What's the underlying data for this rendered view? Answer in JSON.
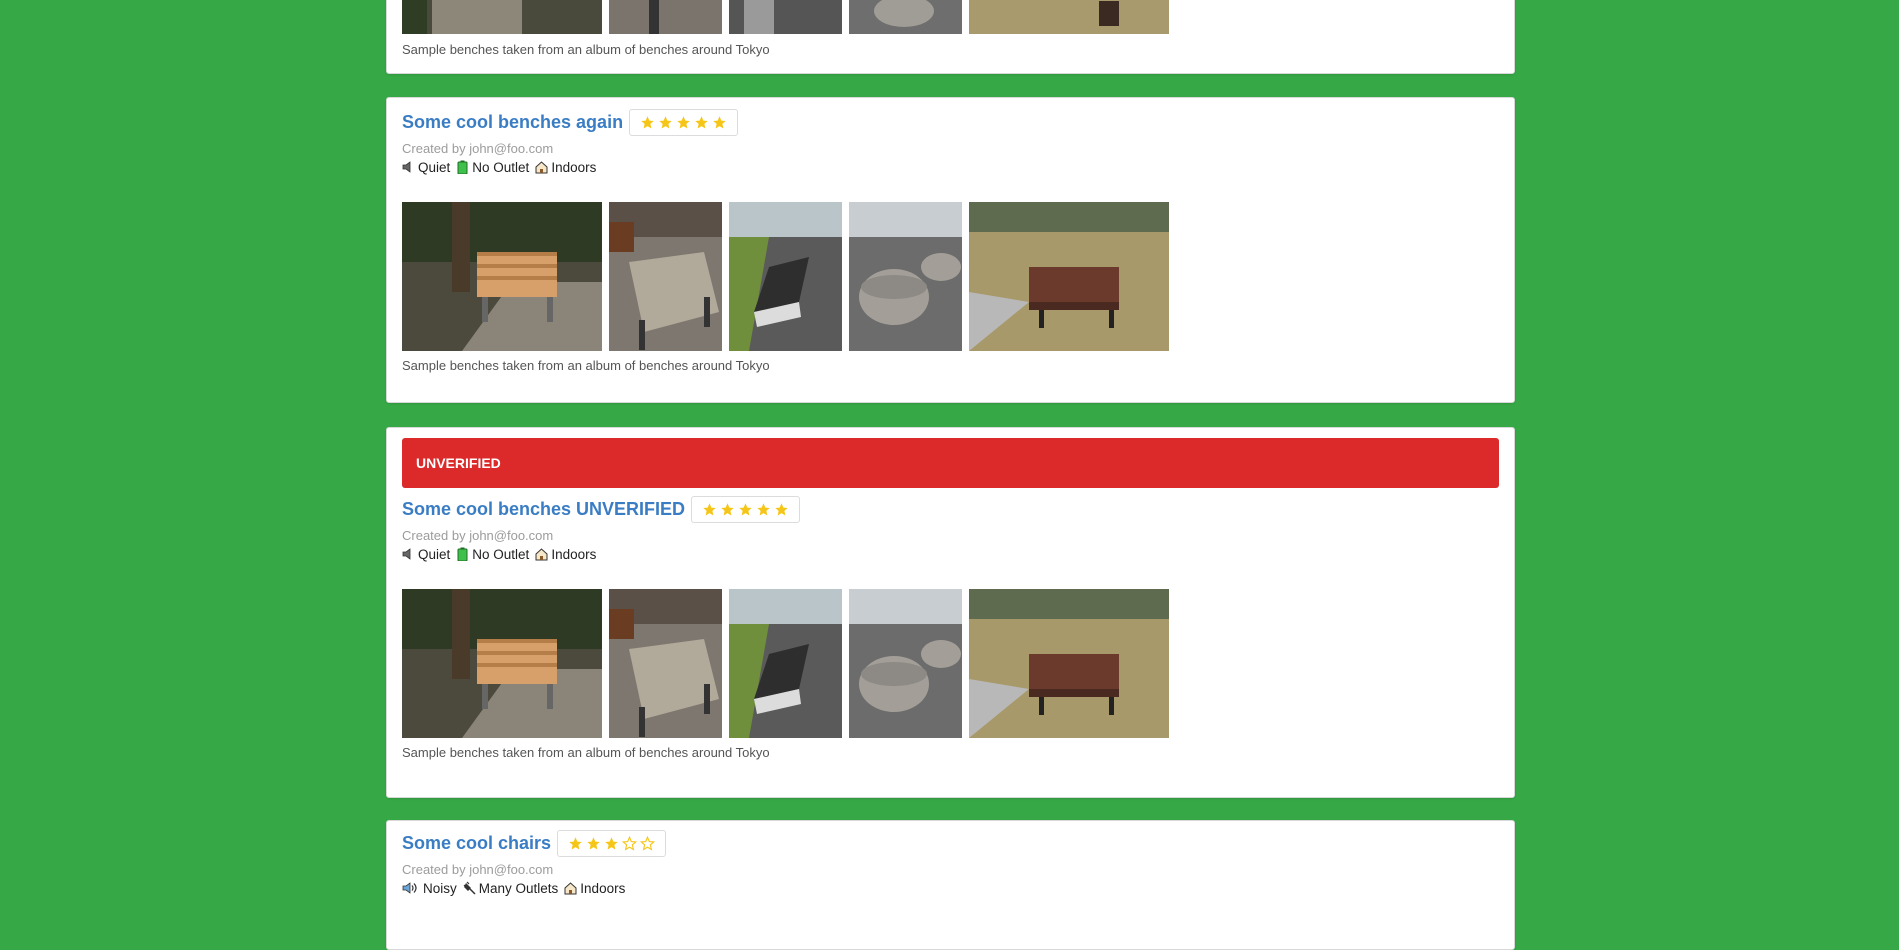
{
  "caption_text": "Sample benches taken from an album of benches around Tokyo",
  "cards": [
    {
      "title": "Some cool benches again",
      "rating": 5,
      "created_by": "Created by john@foo.com",
      "attrs": [
        {
          "icon": "speaker-quiet-icon",
          "label": "Quiet"
        },
        {
          "icon": "battery-icon",
          "label": "No Outlet"
        },
        {
          "icon": "house-icon",
          "label": "Indoors"
        }
      ],
      "caption": "Sample benches taken from an album of benches around Tokyo"
    },
    {
      "banner": "UNVERIFIED",
      "title": "Some cool benches UNVERIFIED",
      "rating": 5,
      "created_by": "Created by john@foo.com",
      "attrs": [
        {
          "icon": "speaker-quiet-icon",
          "label": "Quiet"
        },
        {
          "icon": "battery-icon",
          "label": "No Outlet"
        },
        {
          "icon": "house-icon",
          "label": "Indoors"
        }
      ],
      "caption": "Sample benches taken from an album of benches around Tokyo"
    },
    {
      "title": "Some cool chairs",
      "rating": 3,
      "created_by": "Created by john@foo.com",
      "attrs": [
        {
          "icon": "speaker-loud-icon",
          "label": "Noisy"
        },
        {
          "icon": "plug-icon",
          "label": "Many Outlets"
        },
        {
          "icon": "house-icon",
          "label": "Indoors"
        }
      ]
    }
  ],
  "colors": {
    "background": "#36a946",
    "title": "#3a7dc4",
    "star": "#f5c518",
    "banner": "#dc2a2a"
  }
}
